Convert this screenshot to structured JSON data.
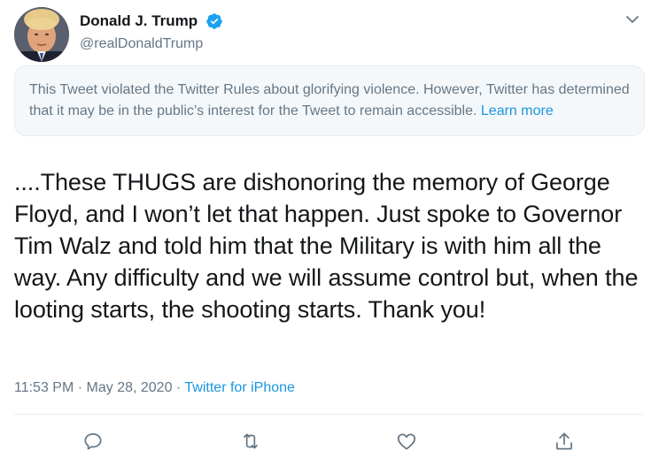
{
  "tweet": {
    "author": {
      "display_name": "Donald J. Trump",
      "handle": "@realDonaldTrump",
      "verified": true
    },
    "notice": {
      "text": "This Tweet violated the Twitter Rules about glorifying violence. However, Twitter has determined that it may be in the public’s interest for the Tweet to remain accessible.",
      "link_label": "Learn more"
    },
    "text": "....These THUGS are dishonoring the memory of George Floyd, and I won’t let that happen. Just spoke to Governor Tim Walz and told him that the Military is with him all the way. Any difficulty and we will assume control but, when the looting starts, the shooting starts. Thank you!",
    "timestamp": "11:53 PM · May 28, 2020 · ",
    "source": "Twitter for iPhone"
  },
  "icons": {
    "verified": "verified-badge-icon",
    "caret": "chevron-down-icon",
    "reply": "reply-icon",
    "retweet": "retweet-icon",
    "like": "like-icon",
    "share": "share-icon"
  },
  "colors": {
    "accent": "#1b95e0",
    "secondary_text": "#657786",
    "notice_bg": "#f5f8fa",
    "border": "#e6ecf0",
    "primary_text": "#14171a"
  }
}
